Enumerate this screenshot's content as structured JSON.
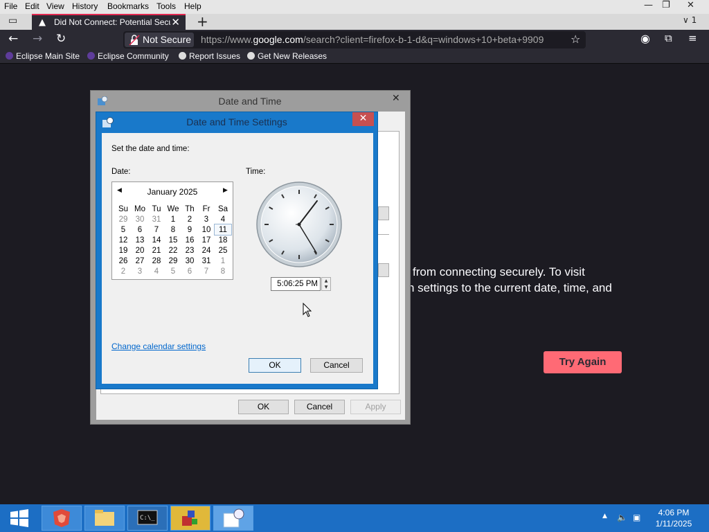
{
  "menu": [
    "File",
    "Edit",
    "View",
    "History",
    "Bookmarks",
    "Tools",
    "Help"
  ],
  "tab": {
    "title": "Did Not Connect: Potential Secu",
    "close": "✕"
  },
  "tab_count_badge": "1",
  "url": {
    "security_label": "Not Secure",
    "prefix": "https://www.",
    "domain": "google.com",
    "rest": "/search?client=firefox-b-1-d&q=windows+10+beta+9909"
  },
  "bookmarks": [
    "Eclipse Main Site",
    "Eclipse Community",
    "Report Issues",
    "Get New Releases"
  ],
  "page": {
    "line1": "from connecting securely. To visit",
    "line2": "n settings to the current date, time, and",
    "try_again": "Try Again"
  },
  "outer_dialog": {
    "title": "Date and Time",
    "ok": "OK",
    "cancel": "Cancel",
    "apply": "Apply"
  },
  "inner_dialog": {
    "title": "Date and Time Settings",
    "instruction": "Set the date and time:",
    "date_label": "Date:",
    "time_label": "Time:",
    "month": "January 2025",
    "weekdays": [
      "Su",
      "Mo",
      "Tu",
      "We",
      "Th",
      "Fr",
      "Sa"
    ],
    "weeks": [
      [
        "29",
        "30",
        "31",
        "1",
        "2",
        "3",
        "4"
      ],
      [
        "5",
        "6",
        "7",
        "8",
        "9",
        "10",
        "11"
      ],
      [
        "12",
        "13",
        "14",
        "15",
        "16",
        "17",
        "18"
      ],
      [
        "19",
        "20",
        "21",
        "22",
        "23",
        "24",
        "25"
      ],
      [
        "26",
        "27",
        "28",
        "29",
        "30",
        "31",
        "1"
      ],
      [
        "2",
        "3",
        "4",
        "5",
        "6",
        "7",
        "8"
      ]
    ],
    "selected_day": "11",
    "time_value": "5:06:25 PM",
    "change_calendar_link": "Change calendar settings",
    "ok": "OK",
    "cancel": "Cancel"
  },
  "taskbar": {
    "time": "4:06 PM",
    "date": "1/11/2025"
  },
  "colors": {
    "accent": "#1979ca",
    "try_again": "#ff6a75",
    "taskbar": "#1c6ec4"
  }
}
